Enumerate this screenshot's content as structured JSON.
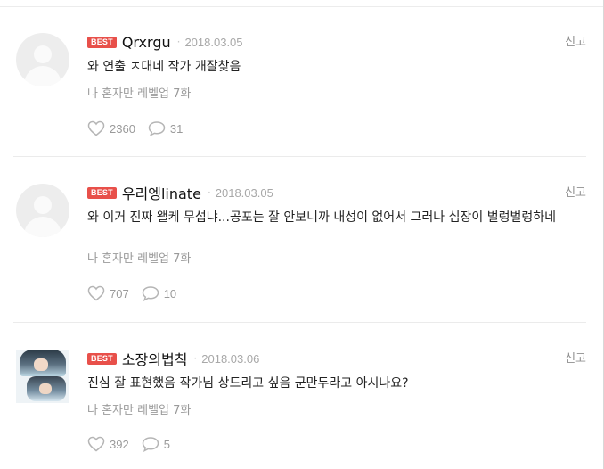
{
  "comments": [
    {
      "badge": "BEST",
      "username": "Qrxrgu",
      "date": "2018.03.05",
      "report": "신고",
      "text": "와 연출 ㅈ대네 작가 개잘찾음",
      "episode": "나 혼자만 레벨업 7화",
      "likes": "2360",
      "replies": "31",
      "avatar": "default-avatar"
    },
    {
      "badge": "BEST",
      "username": "우리엥linate",
      "date": "2018.03.05",
      "report": "신고",
      "text": "와 이거 진짜 왤케 무섭냐...공포는 잘 안보니까 내성이 없어서 그러나 심장이 벌렁벌렁하네",
      "episode": "나 혼자만 레벨업 7화",
      "likes": "707",
      "replies": "10",
      "avatar": "default-avatar"
    },
    {
      "badge": "BEST",
      "username": "소장의법칙",
      "date": "2018.03.06",
      "report": "신고",
      "text": "진심 잘 표현했음 작가님 상드리고 싶음 군만두라고 아시나요?",
      "episode": "나 혼자만 레벨업 7화",
      "likes": "392",
      "replies": "5",
      "avatar": "photo-avatar"
    }
  ],
  "colors": {
    "badge": "#e8504a",
    "muted": "#9a9a9a",
    "divider": "#ebebeb"
  }
}
